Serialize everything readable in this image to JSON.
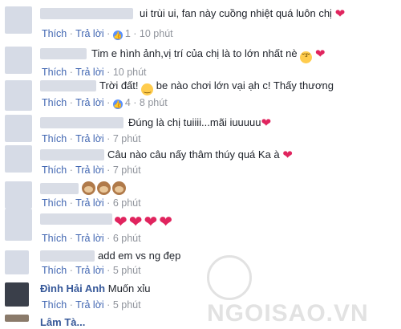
{
  "labels": {
    "like": "Thích",
    "reply": "Trả lời",
    "dot": "·"
  },
  "colors": {
    "link": "#4267b2",
    "meta": "#90949c",
    "heart": "#e0245e",
    "like_badge": "#5890ff"
  },
  "comments": [
    {
      "text": "ui trùi ui, fan này cuồng nhiệt quá luôn chị",
      "likes": "1",
      "time": "10 phút",
      "icons": [
        "heart-icon"
      ]
    },
    {
      "text": "Tim e hình ảnh,vị trí của chị là to lớn nhất nè",
      "time": "10 phút",
      "icons": [
        "kiss-emoji-icon",
        "heart-icon"
      ]
    },
    {
      "text_a": "Trời đất!",
      "text_b": "be nào chơi lớn vại ạh c! Thấy thương",
      "likes": "4",
      "time": "8 phút",
      "icons": [
        "smile-emoji-icon"
      ]
    },
    {
      "text": "Đúng là chị tuiiii...mãi iuuuuu",
      "time": "7 phút",
      "icons": [
        "heart-icon"
      ]
    },
    {
      "text": "Câu nào câu nấy thâm thúy quá Ka à",
      "time": "7 phút",
      "icons": [
        "heart-icon"
      ]
    },
    {
      "time": "6 phút",
      "icons": [
        "monkey-emoji-icon",
        "monkey-emoji-icon",
        "monkey-emoji-icon"
      ]
    },
    {
      "time": "6 phút",
      "icons": [
        "heart-icon",
        "heart-icon",
        "heart-icon",
        "heart-icon"
      ]
    },
    {
      "text": "add em vs ng đẹp",
      "time": "5 phút"
    },
    {
      "name": "Đình Hải Anh",
      "text": "Muốn xỉu",
      "time": "5 phút"
    }
  ],
  "partial_next": {
    "text": "Lâm Tà..."
  },
  "watermark": {
    "text": "NGOISAO.VN"
  }
}
